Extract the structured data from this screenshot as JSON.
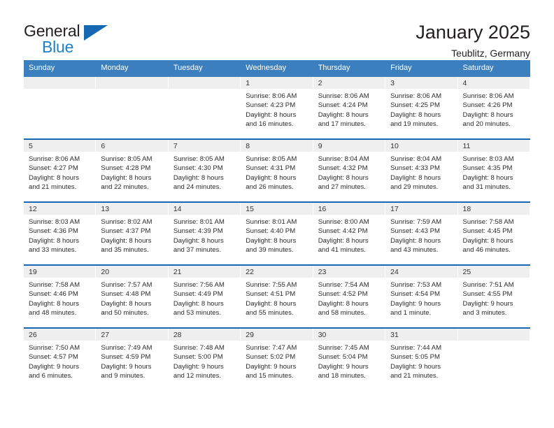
{
  "brand": {
    "name_part1": "General",
    "name_part2": "Blue",
    "triangle_color": "#1668b3"
  },
  "header": {
    "title": "January 2025",
    "subtitle": "Teublitz, Germany"
  },
  "colors": {
    "header_blue": "#3c7fbf",
    "separator_blue": "#1668b3",
    "date_strip_gray": "#efefef"
  },
  "weekdays": [
    "Sunday",
    "Monday",
    "Tuesday",
    "Wednesday",
    "Thursday",
    "Friday",
    "Saturday"
  ],
  "weeks": [
    [
      {
        "day": "",
        "empty": true
      },
      {
        "day": "",
        "empty": true
      },
      {
        "day": "",
        "empty": true
      },
      {
        "day": "1",
        "sunrise": "Sunrise: 8:06 AM",
        "sunset": "Sunset: 4:23 PM",
        "daylight_l1": "Daylight: 8 hours",
        "daylight_l2": "and 16 minutes."
      },
      {
        "day": "2",
        "sunrise": "Sunrise: 8:06 AM",
        "sunset": "Sunset: 4:24 PM",
        "daylight_l1": "Daylight: 8 hours",
        "daylight_l2": "and 17 minutes."
      },
      {
        "day": "3",
        "sunrise": "Sunrise: 8:06 AM",
        "sunset": "Sunset: 4:25 PM",
        "daylight_l1": "Daylight: 8 hours",
        "daylight_l2": "and 19 minutes."
      },
      {
        "day": "4",
        "sunrise": "Sunrise: 8:06 AM",
        "sunset": "Sunset: 4:26 PM",
        "daylight_l1": "Daylight: 8 hours",
        "daylight_l2": "and 20 minutes."
      }
    ],
    [
      {
        "day": "5",
        "sunrise": "Sunrise: 8:06 AM",
        "sunset": "Sunset: 4:27 PM",
        "daylight_l1": "Daylight: 8 hours",
        "daylight_l2": "and 21 minutes."
      },
      {
        "day": "6",
        "sunrise": "Sunrise: 8:05 AM",
        "sunset": "Sunset: 4:28 PM",
        "daylight_l1": "Daylight: 8 hours",
        "daylight_l2": "and 22 minutes."
      },
      {
        "day": "7",
        "sunrise": "Sunrise: 8:05 AM",
        "sunset": "Sunset: 4:30 PM",
        "daylight_l1": "Daylight: 8 hours",
        "daylight_l2": "and 24 minutes."
      },
      {
        "day": "8",
        "sunrise": "Sunrise: 8:05 AM",
        "sunset": "Sunset: 4:31 PM",
        "daylight_l1": "Daylight: 8 hours",
        "daylight_l2": "and 26 minutes."
      },
      {
        "day": "9",
        "sunrise": "Sunrise: 8:04 AM",
        "sunset": "Sunset: 4:32 PM",
        "daylight_l1": "Daylight: 8 hours",
        "daylight_l2": "and 27 minutes."
      },
      {
        "day": "10",
        "sunrise": "Sunrise: 8:04 AM",
        "sunset": "Sunset: 4:33 PM",
        "daylight_l1": "Daylight: 8 hours",
        "daylight_l2": "and 29 minutes."
      },
      {
        "day": "11",
        "sunrise": "Sunrise: 8:03 AM",
        "sunset": "Sunset: 4:35 PM",
        "daylight_l1": "Daylight: 8 hours",
        "daylight_l2": "and 31 minutes."
      }
    ],
    [
      {
        "day": "12",
        "sunrise": "Sunrise: 8:03 AM",
        "sunset": "Sunset: 4:36 PM",
        "daylight_l1": "Daylight: 8 hours",
        "daylight_l2": "and 33 minutes."
      },
      {
        "day": "13",
        "sunrise": "Sunrise: 8:02 AM",
        "sunset": "Sunset: 4:37 PM",
        "daylight_l1": "Daylight: 8 hours",
        "daylight_l2": "and 35 minutes."
      },
      {
        "day": "14",
        "sunrise": "Sunrise: 8:01 AM",
        "sunset": "Sunset: 4:39 PM",
        "daylight_l1": "Daylight: 8 hours",
        "daylight_l2": "and 37 minutes."
      },
      {
        "day": "15",
        "sunrise": "Sunrise: 8:01 AM",
        "sunset": "Sunset: 4:40 PM",
        "daylight_l1": "Daylight: 8 hours",
        "daylight_l2": "and 39 minutes."
      },
      {
        "day": "16",
        "sunrise": "Sunrise: 8:00 AM",
        "sunset": "Sunset: 4:42 PM",
        "daylight_l1": "Daylight: 8 hours",
        "daylight_l2": "and 41 minutes."
      },
      {
        "day": "17",
        "sunrise": "Sunrise: 7:59 AM",
        "sunset": "Sunset: 4:43 PM",
        "daylight_l1": "Daylight: 8 hours",
        "daylight_l2": "and 43 minutes."
      },
      {
        "day": "18",
        "sunrise": "Sunrise: 7:58 AM",
        "sunset": "Sunset: 4:45 PM",
        "daylight_l1": "Daylight: 8 hours",
        "daylight_l2": "and 46 minutes."
      }
    ],
    [
      {
        "day": "19",
        "sunrise": "Sunrise: 7:58 AM",
        "sunset": "Sunset: 4:46 PM",
        "daylight_l1": "Daylight: 8 hours",
        "daylight_l2": "and 48 minutes."
      },
      {
        "day": "20",
        "sunrise": "Sunrise: 7:57 AM",
        "sunset": "Sunset: 4:48 PM",
        "daylight_l1": "Daylight: 8 hours",
        "daylight_l2": "and 50 minutes."
      },
      {
        "day": "21",
        "sunrise": "Sunrise: 7:56 AM",
        "sunset": "Sunset: 4:49 PM",
        "daylight_l1": "Daylight: 8 hours",
        "daylight_l2": "and 53 minutes."
      },
      {
        "day": "22",
        "sunrise": "Sunrise: 7:55 AM",
        "sunset": "Sunset: 4:51 PM",
        "daylight_l1": "Daylight: 8 hours",
        "daylight_l2": "and 55 minutes."
      },
      {
        "day": "23",
        "sunrise": "Sunrise: 7:54 AM",
        "sunset": "Sunset: 4:52 PM",
        "daylight_l1": "Daylight: 8 hours",
        "daylight_l2": "and 58 minutes."
      },
      {
        "day": "24",
        "sunrise": "Sunrise: 7:53 AM",
        "sunset": "Sunset: 4:54 PM",
        "daylight_l1": "Daylight: 9 hours",
        "daylight_l2": "and 1 minute."
      },
      {
        "day": "25",
        "sunrise": "Sunrise: 7:51 AM",
        "sunset": "Sunset: 4:55 PM",
        "daylight_l1": "Daylight: 9 hours",
        "daylight_l2": "and 3 minutes."
      }
    ],
    [
      {
        "day": "26",
        "sunrise": "Sunrise: 7:50 AM",
        "sunset": "Sunset: 4:57 PM",
        "daylight_l1": "Daylight: 9 hours",
        "daylight_l2": "and 6 minutes."
      },
      {
        "day": "27",
        "sunrise": "Sunrise: 7:49 AM",
        "sunset": "Sunset: 4:59 PM",
        "daylight_l1": "Daylight: 9 hours",
        "daylight_l2": "and 9 minutes."
      },
      {
        "day": "28",
        "sunrise": "Sunrise: 7:48 AM",
        "sunset": "Sunset: 5:00 PM",
        "daylight_l1": "Daylight: 9 hours",
        "daylight_l2": "and 12 minutes."
      },
      {
        "day": "29",
        "sunrise": "Sunrise: 7:47 AM",
        "sunset": "Sunset: 5:02 PM",
        "daylight_l1": "Daylight: 9 hours",
        "daylight_l2": "and 15 minutes."
      },
      {
        "day": "30",
        "sunrise": "Sunrise: 7:45 AM",
        "sunset": "Sunset: 5:04 PM",
        "daylight_l1": "Daylight: 9 hours",
        "daylight_l2": "and 18 minutes."
      },
      {
        "day": "31",
        "sunrise": "Sunrise: 7:44 AM",
        "sunset": "Sunset: 5:05 PM",
        "daylight_l1": "Daylight: 9 hours",
        "daylight_l2": "and 21 minutes."
      },
      {
        "day": "",
        "empty": true
      }
    ]
  ]
}
